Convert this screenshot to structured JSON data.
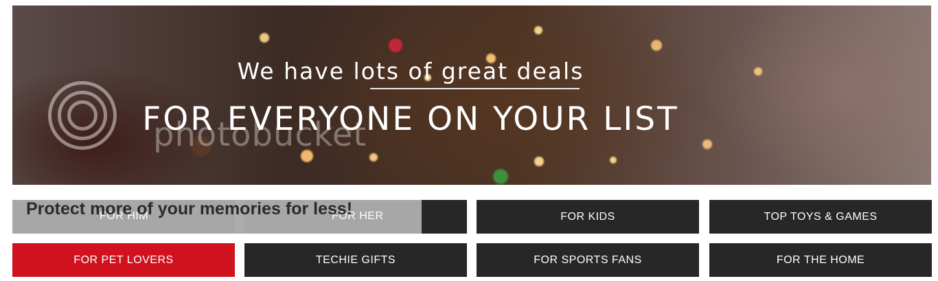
{
  "banner": {
    "headline": "We have lots of great deals",
    "subheadline": "FOR EVERYONE ON YOUR LIST",
    "watermark": "photobucket"
  },
  "overlay": {
    "promo_text": "Protect more of your memories for less!"
  },
  "categories": [
    {
      "label": "FOR HIM"
    },
    {
      "label": "FOR HER"
    },
    {
      "label": "FOR KIDS"
    },
    {
      "label": "TOP TOYS & GAMES"
    },
    {
      "label": "FOR PET LOVERS"
    },
    {
      "label": "TECHIE GIFTS"
    },
    {
      "label": "FOR SPORTS FANS"
    },
    {
      "label": "FOR THE HOME"
    }
  ],
  "colors": {
    "button_dark": "#272727",
    "button_active": "#d0121f",
    "overlay_gray": "#aaaaaa"
  }
}
